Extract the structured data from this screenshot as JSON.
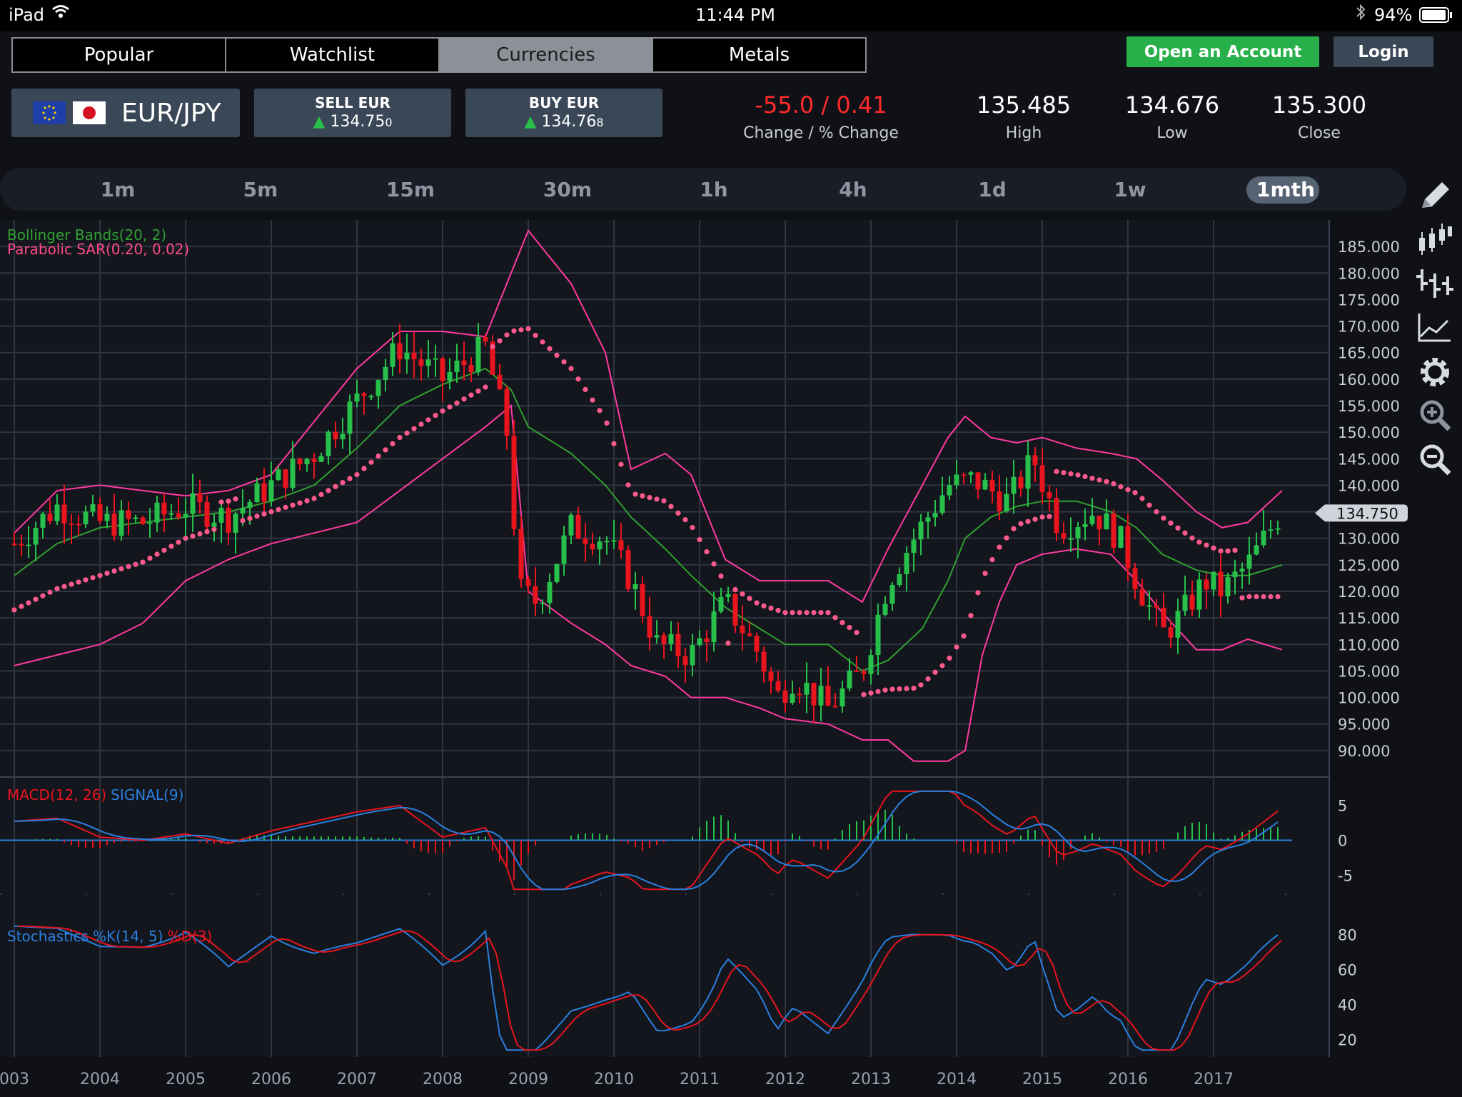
{
  "status_bar": {
    "device": "iPad",
    "time": "11:44 PM",
    "battery": "94%"
  },
  "nav_tabs": [
    {
      "label": "Popular",
      "active": false
    },
    {
      "label": "Watchlist",
      "active": false
    },
    {
      "label": "Currencies",
      "active": true
    },
    {
      "label": "Metals",
      "active": false
    }
  ],
  "header_buttons": {
    "open_account": "Open an Account",
    "login": "Login"
  },
  "instrument": {
    "pair": "EUR/JPY",
    "flags": [
      "eu-flag-icon",
      "jp-flag-icon"
    ]
  },
  "sell": {
    "label": "SELL EUR",
    "price": "134.75",
    "pip": "0"
  },
  "buy": {
    "label": "BUY EUR",
    "price": "134.76",
    "pip": "8"
  },
  "stats": {
    "change_value": "-55.0 / 0.41",
    "change_label": "Change / % Change",
    "high_value": "135.485",
    "high_label": "High",
    "low_value": "134.676",
    "low_label": "Low",
    "close_value": "135.300",
    "close_label": "Close"
  },
  "timeframes": [
    "1m",
    "5m",
    "15m",
    "30m",
    "1h",
    "4h",
    "1d",
    "1w",
    "1mth"
  ],
  "active_timeframe": "1mth",
  "toolbar_icons": [
    "pencil-icon",
    "candlestick-icon",
    "ohlc-bars-icon",
    "line-chart-icon",
    "settings-gear-icon",
    "zoom-in-icon",
    "zoom-out-icon"
  ],
  "colors": {
    "up": "#27c04a",
    "down": "#e8141e",
    "bollinger_mid": "#30a030",
    "bollinger_band": "#ff3aa0",
    "sar": "#ff5a8c",
    "macd": "#e8141e",
    "signal": "#2a80e0",
    "accent_green": "#27b04a"
  },
  "chart_data": [
    {
      "type": "candlestick",
      "title": "EUR/JPY monthly",
      "indicators": [
        "Bollinger Bands(20, 2)",
        "Parabolic SAR(0.20, 0.02)"
      ],
      "x_ticks": [
        "003",
        "2004",
        "2005",
        "2006",
        "2007",
        "2008",
        "2009",
        "2010",
        "2011",
        "2012",
        "2013",
        "2014",
        "2015",
        "2016",
        "2017"
      ],
      "y_ticks": [
        "185.000",
        "180.000",
        "175.000",
        "170.000",
        "165.000",
        "160.000",
        "155.000",
        "150.000",
        "145.000",
        "140.000",
        "135.000",
        "130.000",
        "125.000",
        "120.000",
        "115.000",
        "110.000",
        "105.000",
        "100.000",
        "95.000",
        "90.000"
      ],
      "ylim": [
        85,
        190
      ],
      "last_price_label": "134.750",
      "close_path": [
        [
          2003.0,
          129
        ],
        [
          2003.5,
          136
        ],
        [
          2004.0,
          133
        ],
        [
          2004.5,
          133
        ],
        [
          2005.0,
          136
        ],
        [
          2005.5,
          134
        ],
        [
          2006.0,
          140
        ],
        [
          2006.5,
          146
        ],
        [
          2007.0,
          156
        ],
        [
          2007.5,
          166
        ],
        [
          2008.0,
          160
        ],
        [
          2008.5,
          166
        ],
        [
          2008.75,
          150
        ],
        [
          2008.9,
          120
        ],
        [
          2009.1,
          118
        ],
        [
          2009.5,
          132
        ],
        [
          2009.9,
          130
        ],
        [
          2010.2,
          122
        ],
        [
          2010.5,
          110
        ],
        [
          2010.9,
          108
        ],
        [
          2011.3,
          118
        ],
        [
          2011.7,
          108
        ],
        [
          2011.9,
          100
        ],
        [
          2012.1,
          104
        ],
        [
          2012.5,
          98
        ],
        [
          2012.9,
          105
        ],
        [
          2013.2,
          122
        ],
        [
          2013.5,
          130
        ],
        [
          2013.9,
          140
        ],
        [
          2014.2,
          141
        ],
        [
          2014.6,
          137
        ],
        [
          2014.9,
          145
        ],
        [
          2015.2,
          132
        ],
        [
          2015.6,
          135
        ],
        [
          2015.9,
          130
        ],
        [
          2016.1,
          122
        ],
        [
          2016.4,
          112
        ],
        [
          2016.6,
          115
        ],
        [
          2016.9,
          122
        ],
        [
          2017.1,
          120
        ],
        [
          2017.4,
          125
        ],
        [
          2017.8,
          135.3
        ]
      ],
      "bb_upper": [
        [
          2003,
          131
        ],
        [
          2003.5,
          139
        ],
        [
          2004,
          140
        ],
        [
          2004.5,
          139
        ],
        [
          2005,
          138
        ],
        [
          2005.5,
          139
        ],
        [
          2006,
          142
        ],
        [
          2006.5,
          152
        ],
        [
          2007,
          162
        ],
        [
          2007.5,
          169
        ],
        [
          2008,
          169
        ],
        [
          2008.5,
          168
        ],
        [
          2008.8,
          180
        ],
        [
          2009,
          188
        ],
        [
          2009.5,
          178
        ],
        [
          2009.9,
          165
        ],
        [
          2010.2,
          143
        ],
        [
          2010.6,
          146
        ],
        [
          2010.9,
          142
        ],
        [
          2011.3,
          126
        ],
        [
          2011.7,
          122
        ],
        [
          2012,
          122
        ],
        [
          2012.5,
          122
        ],
        [
          2012.9,
          118
        ],
        [
          2013.2,
          128
        ],
        [
          2013.6,
          140
        ],
        [
          2013.9,
          149
        ],
        [
          2014.1,
          153
        ],
        [
          2014.4,
          149
        ],
        [
          2014.7,
          148
        ],
        [
          2015,
          149
        ],
        [
          2015.4,
          147
        ],
        [
          2015.8,
          146
        ],
        [
          2016.1,
          145
        ],
        [
          2016.4,
          141
        ],
        [
          2016.8,
          135
        ],
        [
          2017.1,
          132
        ],
        [
          2017.4,
          133
        ],
        [
          2017.8,
          139
        ]
      ],
      "bb_mid": [
        [
          2003,
          123
        ],
        [
          2003.5,
          129
        ],
        [
          2004,
          132
        ],
        [
          2004.5,
          133
        ],
        [
          2005,
          134
        ],
        [
          2005.5,
          135
        ],
        [
          2006,
          137
        ],
        [
          2006.5,
          140
        ],
        [
          2007,
          147
        ],
        [
          2007.5,
          155
        ],
        [
          2008,
          159
        ],
        [
          2008.5,
          162
        ],
        [
          2008.8,
          158
        ],
        [
          2009,
          151
        ],
        [
          2009.5,
          146
        ],
        [
          2009.9,
          140
        ],
        [
          2010.2,
          134
        ],
        [
          2010.6,
          128
        ],
        [
          2010.9,
          123
        ],
        [
          2011.3,
          117
        ],
        [
          2011.7,
          113
        ],
        [
          2012,
          110
        ],
        [
          2012.5,
          110
        ],
        [
          2012.9,
          105
        ],
        [
          2013.2,
          107
        ],
        [
          2013.6,
          113
        ],
        [
          2013.9,
          122
        ],
        [
          2014.1,
          130
        ],
        [
          2014.4,
          134
        ],
        [
          2014.7,
          136
        ],
        [
          2015,
          137
        ],
        [
          2015.4,
          137
        ],
        [
          2015.8,
          135
        ],
        [
          2016.1,
          132
        ],
        [
          2016.4,
          127
        ],
        [
          2016.8,
          124
        ],
        [
          2017.1,
          123
        ],
        [
          2017.4,
          123
        ],
        [
          2017.8,
          125
        ]
      ],
      "bb_lower": [
        [
          2003,
          106
        ],
        [
          2003.5,
          108
        ],
        [
          2004,
          110
        ],
        [
          2004.5,
          114
        ],
        [
          2005,
          122
        ],
        [
          2005.5,
          126
        ],
        [
          2006,
          129
        ],
        [
          2006.5,
          131
        ],
        [
          2007,
          133
        ],
        [
          2007.5,
          139
        ],
        [
          2008,
          145
        ],
        [
          2008.5,
          151
        ],
        [
          2008.8,
          155
        ],
        [
          2009,
          120
        ],
        [
          2009.5,
          114
        ],
        [
          2009.9,
          110
        ],
        [
          2010.2,
          106
        ],
        [
          2010.6,
          104
        ],
        [
          2010.9,
          100
        ],
        [
          2011.3,
          100
        ],
        [
          2011.7,
          98
        ],
        [
          2012,
          96
        ],
        [
          2012.5,
          95
        ],
        [
          2012.9,
          92
        ],
        [
          2013.2,
          92
        ],
        [
          2013.5,
          88
        ],
        [
          2013.9,
          88
        ],
        [
          2014.1,
          90
        ],
        [
          2014.3,
          108
        ],
        [
          2014.5,
          118
        ],
        [
          2014.7,
          125
        ],
        [
          2015,
          127
        ],
        [
          2015.4,
          128
        ],
        [
          2015.8,
          127
        ],
        [
          2016.1,
          122
        ],
        [
          2016.4,
          116
        ],
        [
          2016.8,
          109
        ],
        [
          2017.1,
          109
        ],
        [
          2017.4,
          111
        ],
        [
          2017.8,
          109
        ]
      ]
    },
    {
      "type": "line",
      "title": "MACD(12, 26) SIGNAL(9)",
      "series": [
        {
          "name": "MACD(12, 26)"
        },
        {
          "name": "SIGNAL(9)"
        }
      ],
      "y_ticks": [
        "5",
        "0",
        "-5"
      ],
      "ylim": [
        -8,
        8
      ]
    },
    {
      "type": "line",
      "title": "Stochastics %K(14, 5) %D(3)",
      "series": [
        {
          "name": "%K(14, 5)"
        },
        {
          "name": "%D(3)"
        }
      ],
      "y_ticks": [
        "80",
        "60",
        "40",
        "20"
      ],
      "ylim": [
        10,
        95
      ]
    }
  ]
}
